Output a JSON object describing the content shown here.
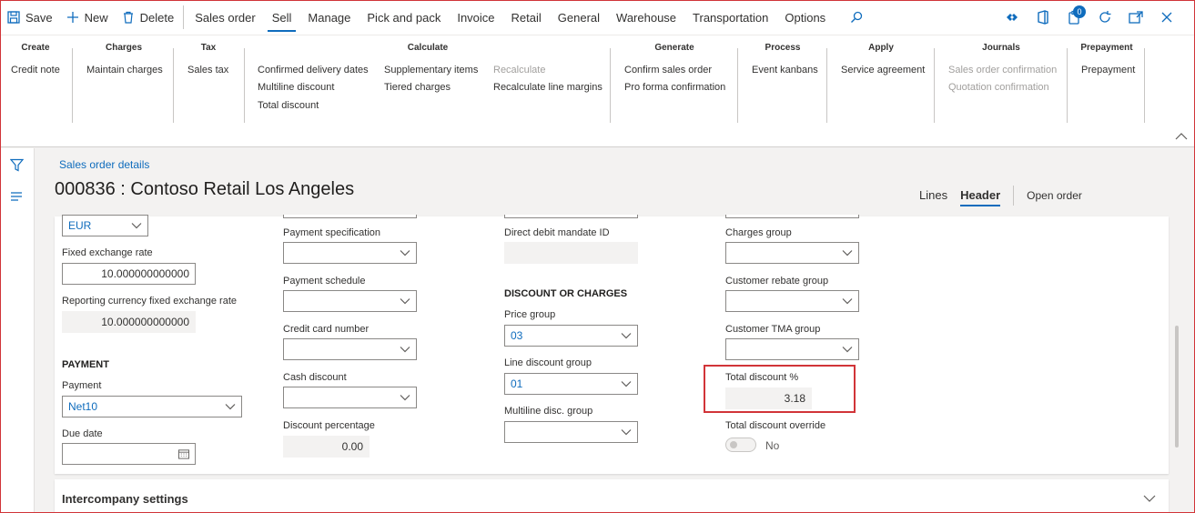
{
  "actionbar": {
    "save_label": "Save",
    "new_label": "New",
    "delete_label": "Delete",
    "tabs": [
      {
        "label": "Sales order",
        "active": false
      },
      {
        "label": "Sell",
        "active": true
      },
      {
        "label": "Manage",
        "active": false
      },
      {
        "label": "Pick and pack",
        "active": false
      },
      {
        "label": "Invoice",
        "active": false
      },
      {
        "label": "Retail",
        "active": false
      },
      {
        "label": "General",
        "active": false
      },
      {
        "label": "Warehouse",
        "active": false
      },
      {
        "label": "Transportation",
        "active": false
      },
      {
        "label": "Options",
        "active": false
      }
    ],
    "notification_count": "0",
    "icons": [
      "save-icon",
      "plus-icon",
      "trash-icon",
      "search-icon",
      "diamond-icon",
      "office-icon",
      "clipboard-icon",
      "refresh-icon",
      "popout-icon",
      "close-icon"
    ]
  },
  "ribbon": {
    "groups": {
      "create": {
        "title": "Create",
        "items": [
          "Credit note"
        ]
      },
      "charges": {
        "title": "Charges",
        "items": [
          "Maintain charges"
        ]
      },
      "tax": {
        "title": "Tax",
        "items": [
          "Sales tax"
        ]
      },
      "calculate": {
        "title": "Calculate",
        "col1": [
          "Confirmed delivery dates",
          "Multiline discount",
          "Total discount"
        ],
        "col2": [
          "Supplementary items",
          "Tiered charges"
        ],
        "col3": [
          "Recalculate",
          "Recalculate line margins"
        ]
      },
      "generate": {
        "title": "Generate",
        "items": [
          "Confirm sales order",
          "Pro forma confirmation"
        ]
      },
      "process": {
        "title": "Process",
        "items": [
          "Event kanbans"
        ]
      },
      "apply": {
        "title": "Apply",
        "items": [
          "Service agreement"
        ]
      },
      "journals": {
        "title": "Journals",
        "items": [
          "Sales order confirmation",
          "Quotation confirmation"
        ]
      },
      "prepayment": {
        "title": "Prepayment",
        "items": [
          "Prepayment"
        ]
      }
    }
  },
  "page": {
    "breadcrumb": "Sales order details",
    "title": "000836 : Contoso Retail Los Angeles",
    "view_tabs": {
      "lines": "Lines",
      "header": "Header"
    },
    "open_order": "Open order"
  },
  "form": {
    "col1": {
      "currency_value": "EUR",
      "fixed_rate_label": "Fixed exchange rate",
      "fixed_rate_value": "10.000000000000",
      "reporting_rate_label": "Reporting currency fixed exchange rate",
      "reporting_rate_value": "10.000000000000",
      "payment_section": "PAYMENT",
      "payment_label": "Payment",
      "payment_value": "Net10",
      "due_date_label": "Due date",
      "due_date_value": ""
    },
    "col2": {
      "payment_spec_label": "Payment specification",
      "payment_schedule_label": "Payment schedule",
      "credit_card_label": "Credit card number",
      "cash_discount_label": "Cash discount",
      "discount_pct_label": "Discount percentage",
      "discount_pct_value": "0.00"
    },
    "col3": {
      "direct_debit_label": "Direct debit mandate ID",
      "direct_debit_value": "",
      "discount_section": "DISCOUNT OR CHARGES",
      "price_group_label": "Price group",
      "price_group_value": "03",
      "line_disc_label": "Line discount group",
      "line_disc_value": "01",
      "multiline_label": "Multiline disc. group",
      "multiline_value": ""
    },
    "col4": {
      "charges_group_label": "Charges group",
      "rebate_group_label": "Customer rebate group",
      "tma_group_label": "Customer TMA group",
      "total_disc_label": "Total discount %",
      "total_disc_value": "3.18",
      "override_label": "Total discount override",
      "override_value": "No"
    }
  },
  "intercompany": {
    "title": "Intercompany settings"
  },
  "colors": {
    "accent": "#0f6cbd",
    "highlight": "#d13438"
  }
}
